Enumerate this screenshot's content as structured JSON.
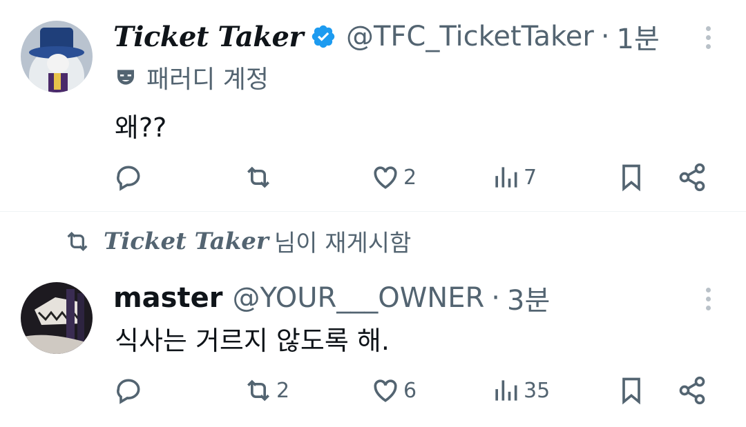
{
  "tweets": [
    {
      "display_name": "Ticket Taker",
      "verified": true,
      "handle": "@TFC_TicketTaker",
      "separator": "·",
      "time": "1분",
      "label": "패러디 계정",
      "text": "왜??",
      "actions": {
        "replies": "",
        "reposts": "",
        "likes": "2",
        "views": "7"
      }
    },
    {
      "retweeted_by": "Ticket Taker",
      "retweet_suffix": "님이 재게시함",
      "display_name": "master",
      "handle": "@YOUR___OWNER",
      "separator": "·",
      "time": "3분",
      "text": "식사는 거르지 않도록 해.",
      "actions": {
        "replies": "",
        "reposts": "2",
        "likes": "6",
        "views": "35"
      }
    }
  ],
  "colors": {
    "verified": "#1d9bf0",
    "muted": "#536471",
    "divider": "#eff3f4"
  },
  "icons": [
    "reply-icon",
    "repost-icon",
    "like-icon",
    "views-icon",
    "bookmark-icon",
    "share-icon",
    "more-icon",
    "verified-badge-icon",
    "mask-icon"
  ]
}
